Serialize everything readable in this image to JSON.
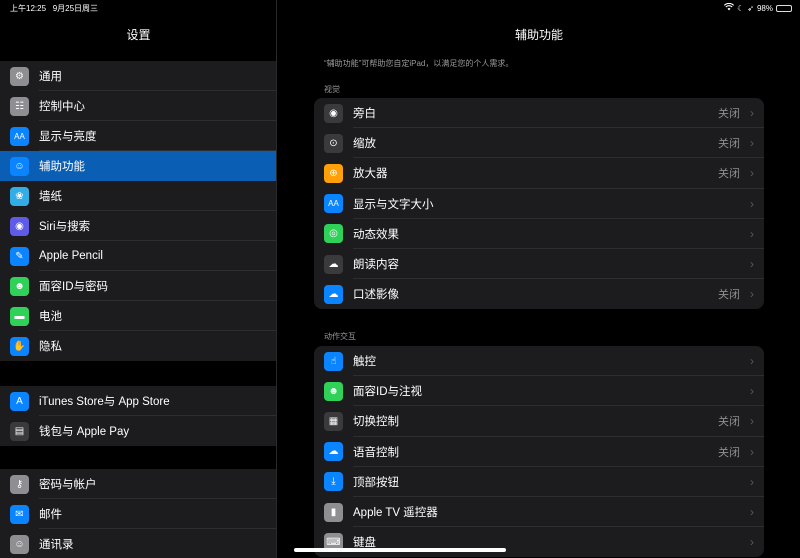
{
  "status": {
    "time": "上午12:25",
    "date": "9月25日周三",
    "battery": "98%",
    "battery_level": 0.98
  },
  "sidebar": {
    "title": "设置",
    "groups": [
      [
        {
          "label": "通用",
          "icon": "gear-icon",
          "color": "#8e8e93",
          "glyph": "⚙"
        },
        {
          "label": "控制中心",
          "icon": "toggles-icon",
          "color": "#8e8e93",
          "glyph": "☷"
        },
        {
          "label": "显示与亮度",
          "icon": "text-size-icon",
          "color": "#0a84ff",
          "glyph": "AA"
        },
        {
          "label": "辅助功能",
          "icon": "accessibility-icon",
          "color": "#0a84ff",
          "glyph": "☺",
          "selected": true
        },
        {
          "label": "墙纸",
          "icon": "wallpaper-icon",
          "color": "#32ade6",
          "glyph": "❀"
        },
        {
          "label": "Siri与搜索",
          "icon": "siri-icon",
          "color": "#5e5ce6",
          "glyph": "◉"
        },
        {
          "label": "Apple Pencil",
          "icon": "pencil-icon",
          "color": "#0a84ff",
          "glyph": "✎"
        },
        {
          "label": "面容ID与密码",
          "icon": "face-id-icon",
          "color": "#30d158",
          "glyph": "☻"
        },
        {
          "label": "电池",
          "icon": "battery-icon",
          "color": "#30d158",
          "glyph": "▬"
        },
        {
          "label": "隐私",
          "icon": "hand-icon",
          "color": "#0a84ff",
          "glyph": "✋"
        }
      ],
      [
        {
          "label": "iTunes Store与 App Store",
          "icon": "app-store-icon",
          "color": "#0a84ff",
          "glyph": "A"
        },
        {
          "label": "钱包与 Apple Pay",
          "icon": "wallet-icon",
          "color": "#3a3a3c",
          "glyph": "▤"
        }
      ],
      [
        {
          "label": "密码与帐户",
          "icon": "key-icon",
          "color": "#8e8e93",
          "glyph": "⚷"
        },
        {
          "label": "邮件",
          "icon": "mail-icon",
          "color": "#0a84ff",
          "glyph": "✉"
        },
        {
          "label": "通讯录",
          "icon": "contacts-icon",
          "color": "#8e8e93",
          "glyph": "☺"
        }
      ]
    ]
  },
  "main": {
    "title": "辅助功能",
    "intro": "“辅助功能”可帮助您自定iPad，以满足您的个人需求。",
    "sections": [
      {
        "label": "视觉",
        "items": [
          {
            "label": "旁白",
            "value": "关闭",
            "icon": "voiceover-icon",
            "color": "#3a3a3c",
            "glyph": "◉"
          },
          {
            "label": "缩放",
            "value": "关闭",
            "icon": "zoom-icon",
            "color": "#3a3a3c",
            "glyph": "⊙"
          },
          {
            "label": "放大器",
            "value": "关闭",
            "icon": "magnifier-icon",
            "color": "#ff9f0a",
            "glyph": "⊕"
          },
          {
            "label": "显示与文字大小",
            "value": "",
            "icon": "text-size-icon",
            "color": "#0a84ff",
            "glyph": "AA"
          },
          {
            "label": "动态效果",
            "value": "",
            "icon": "motion-icon",
            "color": "#30d158",
            "glyph": "◎"
          },
          {
            "label": "朗读内容",
            "value": "",
            "icon": "speech-icon",
            "color": "#3a3a3c",
            "glyph": "☁"
          },
          {
            "label": "口述影像",
            "value": "关闭",
            "icon": "audio-description-icon",
            "color": "#0a84ff",
            "glyph": "☁"
          }
        ]
      },
      {
        "label": "动作交互",
        "items": [
          {
            "label": "触控",
            "value": "",
            "icon": "touch-icon",
            "color": "#0a84ff",
            "glyph": "☝"
          },
          {
            "label": "面容ID与注视",
            "value": "",
            "icon": "face-id-icon",
            "color": "#30d158",
            "glyph": "☻"
          },
          {
            "label": "切换控制",
            "value": "关闭",
            "icon": "switch-control-icon",
            "color": "#3a3a3c",
            "glyph": "▦"
          },
          {
            "label": "语音控制",
            "value": "关闭",
            "icon": "voice-control-icon",
            "color": "#0a84ff",
            "glyph": "☁"
          },
          {
            "label": "顶部按钮",
            "value": "",
            "icon": "top-button-icon",
            "color": "#0a84ff",
            "glyph": "⤓"
          },
          {
            "label": "Apple TV 遥控器",
            "value": "",
            "icon": "remote-icon",
            "color": "#8e8e93",
            "glyph": "▮"
          },
          {
            "label": "键盘",
            "value": "",
            "icon": "keyboard-icon",
            "color": "#8e8e93",
            "glyph": "⌨"
          }
        ]
      }
    ]
  }
}
